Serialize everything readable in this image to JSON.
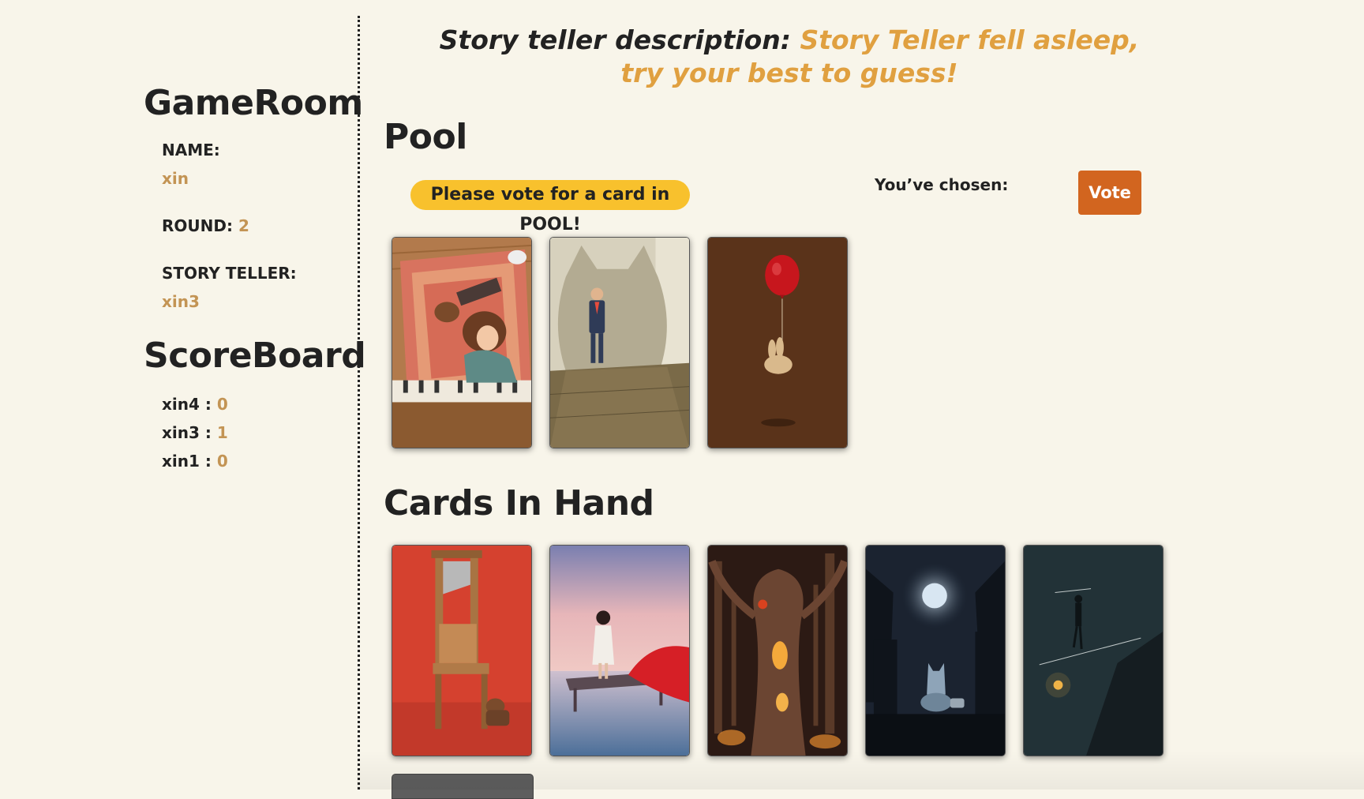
{
  "description": {
    "label": "Story teller description:",
    "text": "Story Teller fell asleep, try your best to guess!"
  },
  "sidebar": {
    "title": "GameRoom",
    "name_label": "NAME:",
    "name_value": "xin",
    "round_label": "ROUND:",
    "round_value": "2",
    "storyteller_label": "STORY TELLER:",
    "storyteller_value": "xin3",
    "scoreboard_title": "ScoreBoard",
    "scores": [
      {
        "player": "xin4",
        "sep": " : ",
        "score": "0"
      },
      {
        "player": "xin3",
        "sep": " : ",
        "score": "1"
      },
      {
        "player": "xin1",
        "sep": " : ",
        "score": "0"
      }
    ]
  },
  "pool": {
    "title": "Pool",
    "prompt": "Please vote for a card in POOL!",
    "chosen_label": "You’ve chosen:",
    "vote_label": "Vote",
    "cards": [
      "piano-girl-card",
      "man-cat-shadow-card",
      "balloon-rabbit-card"
    ]
  },
  "hand": {
    "title": "Cards In Hand",
    "cards": [
      "guillotine-chair-card",
      "girl-red-umbrella-card",
      "forest-tree-house-card",
      "moon-cat-city-card",
      "tightrope-walker-card",
      "hidden-card"
    ]
  },
  "colors": {
    "background": "#f8f5ea",
    "accent": "#c39454",
    "description": "#e0a040",
    "prompt_bg": "#f8c12d",
    "vote_bg": "#d2651f"
  }
}
